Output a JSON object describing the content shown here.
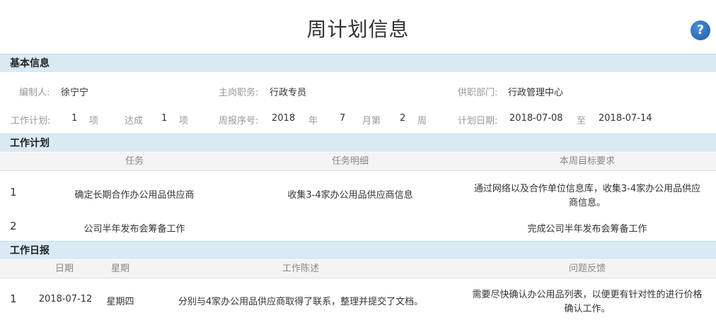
{
  "page": {
    "title": "周计划信息",
    "help_icon": "help-icon",
    "help_glyph": "?"
  },
  "basic": {
    "section_title": "基本信息",
    "editor_label": "编制人:",
    "editor": "徐宁宁",
    "position_label": "主岗职务:",
    "position": "行政专员",
    "dept_label": "供职部门:",
    "dept": "行政管理中心",
    "plan_label": "工作计划:",
    "plan_count": "1",
    "plan_unit": "项",
    "done_label": "达成",
    "done_count": "1",
    "done_unit": "项",
    "weekno_label": "周报序号:",
    "year": "2018",
    "year_unit": "年",
    "month": "7",
    "month_unit": "月第",
    "week": "2",
    "week_unit": "周",
    "date_label": "计划日期:",
    "date_start": "2018-07-08",
    "date_to": "至",
    "date_end": "2018-07-14"
  },
  "plan": {
    "section_title": "工作计划",
    "headers": [
      "任务",
      "任务明细",
      "本周目标要求"
    ],
    "rows": [
      {
        "num": "1",
        "task": "确定长期合作办公用品供应商",
        "detail": "收集3-4家办公用品供应商信息",
        "goal_line1": "通过网络以及合作单位信息库，收集3-4家办公用品供应",
        "goal_line2": "商信息。"
      },
      {
        "num": "2",
        "task": "公司半年发布会筹备工作",
        "detail": "",
        "goal_line1": "完成公司半年发布会筹备工作",
        "goal_line2": ""
      }
    ]
  },
  "daily": {
    "section_title": "工作日报",
    "headers": [
      "日期",
      "星期",
      "工作陈述",
      "问题反馈"
    ],
    "rows": [
      {
        "num": "1",
        "date": "2018-07-12",
        "weekday": "星期四",
        "statement": "分别与4家办公用品供应商取得了联系，整理并提交了文档。",
        "feedback_line1": "需要尽快确认办公用品列表，以便更有针对性的进行价格",
        "feedback_line2": "确认工作。"
      }
    ]
  }
}
